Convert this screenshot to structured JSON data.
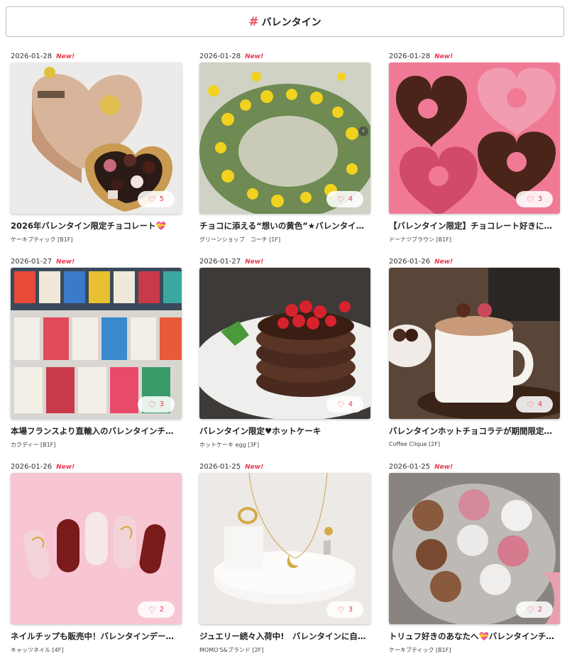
{
  "header": {
    "hash": "#",
    "title": "バレンタイン"
  },
  "new_label": "New!",
  "like_icon": "heart-outline-icon",
  "accent_color": "#e8384f",
  "cards": [
    {
      "date": "2026-01-28",
      "is_new": true,
      "likes": "5",
      "title": "2026年バレンタイン限定チョコレート💝",
      "shop": "ケーキブティック [B1F]"
    },
    {
      "date": "2026-01-28",
      "is_new": true,
      "likes": "4",
      "title": "チョコに添える“想いの黄色”★バレンタインにミモザ",
      "shop": "グリーンショップ　コーチ [1F]"
    },
    {
      "date": "2026-01-28",
      "is_new": true,
      "likes": "3",
      "title": "【バレンタイン限定】チョコレート好きにおすすめ",
      "shop": "ドーナツブラウン [B1F]"
    },
    {
      "date": "2026-01-27",
      "is_new": true,
      "likes": "3",
      "title": "本場フランスより直輸入のバレンタインチョコレート",
      "shop": "カクディー [B1F]"
    },
    {
      "date": "2026-01-27",
      "is_new": true,
      "likes": "4",
      "title": "バレンタイン限定♥ホットケーキ",
      "shop": "ホットケーキ egg [3F]"
    },
    {
      "date": "2026-01-26",
      "is_new": true,
      "likes": "4",
      "title": "バレンタインホットチョコラテが期間限定で販売中",
      "shop": "Coffee Clique [2F]"
    },
    {
      "date": "2026-01-26",
      "is_new": true,
      "likes": "2",
      "title": "ネイルチップも販売中！バレンタインデートに",
      "shop": "キャッツネイル [4F]"
    },
    {
      "date": "2026-01-25",
      "is_new": true,
      "likes": "3",
      "title": "ジュエリー続々入荷中!　バレンタインに自分にも",
      "shop": "MOMO'S&ブランド [2F]"
    },
    {
      "date": "2026-01-25",
      "is_new": true,
      "likes": "2",
      "title": "トリュフ好きのあなたへ💝バレンタインチョコレート",
      "shop": "ケーキブティック [B1F]"
    }
  ]
}
